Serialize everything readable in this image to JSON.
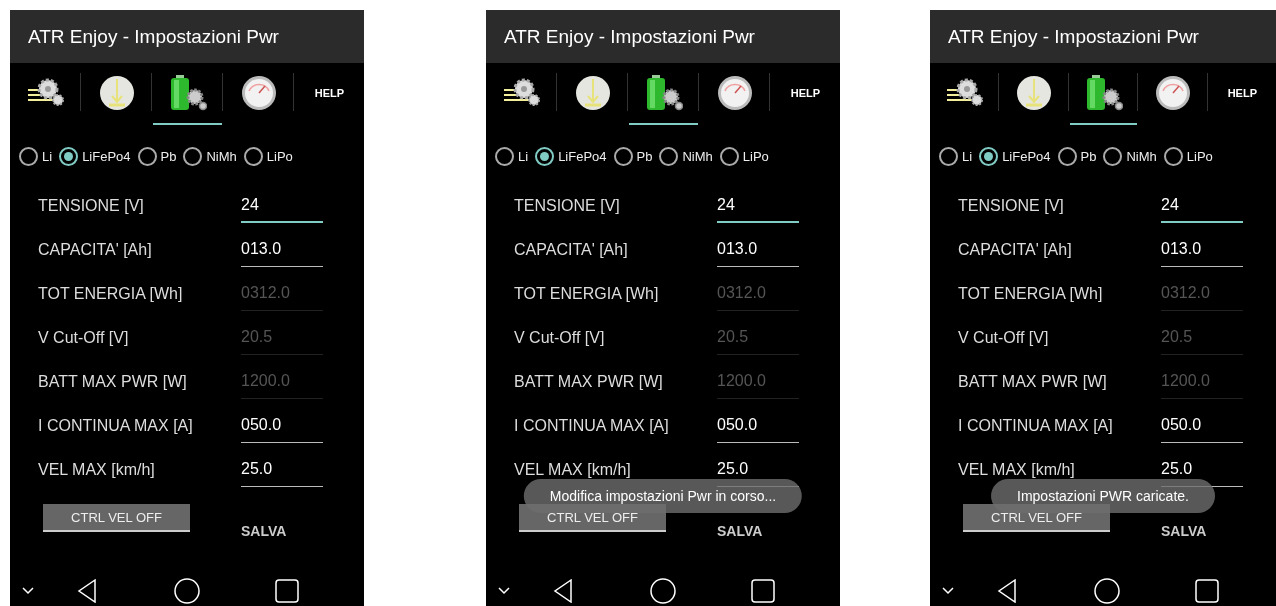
{
  "screens": [
    {
      "title": "ATR Enjoy - Impostazioni Pwr",
      "tabs": [
        {
          "kind": "icon",
          "selected": false
        },
        {
          "kind": "icon",
          "selected": false
        },
        {
          "kind": "icon",
          "selected": true
        },
        {
          "kind": "icon",
          "selected": false
        },
        {
          "kind": "text",
          "label": "HELP",
          "selected": false
        }
      ],
      "battery_types": [
        {
          "label": "Li",
          "selected": false
        },
        {
          "label": "LiFePo4",
          "selected": true
        },
        {
          "label": "Pb",
          "selected": false
        },
        {
          "label": "NiMh",
          "selected": false
        },
        {
          "label": "LiPo",
          "selected": false
        }
      ],
      "fields": [
        {
          "label": "TENSIONE [V]",
          "value": "24",
          "focused": true,
          "disabled": false
        },
        {
          "label": "CAPACITA' [Ah]",
          "value": "013.0",
          "focused": false,
          "disabled": false
        },
        {
          "label": "TOT ENERGIA [Wh]",
          "value": "0312.0",
          "focused": false,
          "disabled": true
        },
        {
          "label": "V Cut-Off [V]",
          "value": "20.5",
          "focused": false,
          "disabled": true
        },
        {
          "label": "BATT MAX PWR [W]",
          "value": "1200.0",
          "focused": false,
          "disabled": true
        },
        {
          "label": "I CONTINUA MAX [A]",
          "value": "050.0",
          "focused": false,
          "disabled": false
        },
        {
          "label": "VEL MAX [km/h]",
          "value": "25.0",
          "focused": false,
          "disabled": false
        }
      ],
      "speed_control_button": "CTRL VEL OFF",
      "save_button": "SALVA"
    },
    {
      "title": "ATR Enjoy - Impostazioni Pwr",
      "tabs": [
        {
          "kind": "icon",
          "selected": false
        },
        {
          "kind": "icon",
          "selected": false
        },
        {
          "kind": "icon",
          "selected": true
        },
        {
          "kind": "icon",
          "selected": false
        },
        {
          "kind": "text",
          "label": "HELP",
          "selected": false
        }
      ],
      "battery_types": [
        {
          "label": "Li",
          "selected": false
        },
        {
          "label": "LiFePo4",
          "selected": true
        },
        {
          "label": "Pb",
          "selected": false
        },
        {
          "label": "NiMh",
          "selected": false
        },
        {
          "label": "LiPo",
          "selected": false
        }
      ],
      "fields": [
        {
          "label": "TENSIONE [V]",
          "value": "24",
          "focused": true,
          "disabled": false
        },
        {
          "label": "CAPACITA' [Ah]",
          "value": "013.0",
          "focused": false,
          "disabled": false
        },
        {
          "label": "TOT ENERGIA [Wh]",
          "value": "0312.0",
          "focused": false,
          "disabled": true
        },
        {
          "label": "V Cut-Off [V]",
          "value": "20.5",
          "focused": false,
          "disabled": true
        },
        {
          "label": "BATT MAX PWR [W]",
          "value": "1200.0",
          "focused": false,
          "disabled": true
        },
        {
          "label": "I CONTINUA MAX [A]",
          "value": "050.0",
          "focused": false,
          "disabled": false
        },
        {
          "label": "VEL MAX [km/h]",
          "value": "25.0",
          "focused": false,
          "disabled": false
        }
      ],
      "speed_control_button": "CTRL VEL OFF",
      "save_button": "SALVA",
      "toast": "Modifica impostazioni Pwr in corso..."
    },
    {
      "title": "ATR Enjoy - Impostazioni Pwr",
      "tabs": [
        {
          "kind": "icon",
          "selected": false
        },
        {
          "kind": "icon",
          "selected": false
        },
        {
          "kind": "icon",
          "selected": true
        },
        {
          "kind": "icon",
          "selected": false
        },
        {
          "kind": "text",
          "label": "HELP",
          "selected": false
        }
      ],
      "battery_types": [
        {
          "label": "Li",
          "selected": false
        },
        {
          "label": "LiFePo4",
          "selected": true
        },
        {
          "label": "Pb",
          "selected": false
        },
        {
          "label": "NiMh",
          "selected": false
        },
        {
          "label": "LiPo",
          "selected": false
        }
      ],
      "fields": [
        {
          "label": "TENSIONE [V]",
          "value": "24",
          "focused": true,
          "disabled": false
        },
        {
          "label": "CAPACITA' [Ah]",
          "value": "013.0",
          "focused": false,
          "disabled": false
        },
        {
          "label": "TOT ENERGIA [Wh]",
          "value": "0312.0",
          "focused": false,
          "disabled": true
        },
        {
          "label": "V Cut-Off [V]",
          "value": "20.5",
          "focused": false,
          "disabled": true
        },
        {
          "label": "BATT MAX PWR [W]",
          "value": "1200.0",
          "focused": false,
          "disabled": true
        },
        {
          "label": "I CONTINUA MAX [A]",
          "value": "050.0",
          "focused": false,
          "disabled": false
        },
        {
          "label": "VEL MAX [km/h]",
          "value": "25.0",
          "focused": false,
          "disabled": false
        }
      ],
      "speed_control_button": "CTRL VEL OFF",
      "save_button": "SALVA",
      "toast": "Impostazioni PWR caricate."
    }
  ]
}
